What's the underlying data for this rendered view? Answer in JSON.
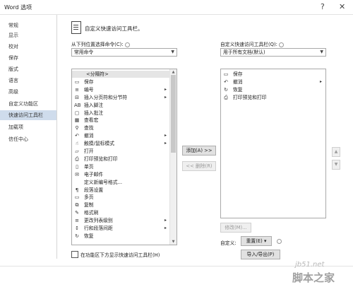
{
  "window": {
    "title": "Word 选项",
    "help_glyph": "?",
    "close_glyph": "✕"
  },
  "nav": {
    "items": [
      {
        "label": "常规"
      },
      {
        "label": "显示"
      },
      {
        "label": "校对"
      },
      {
        "label": "保存"
      },
      {
        "label": "版式"
      },
      {
        "label": "语言"
      },
      {
        "label": "高级"
      },
      {
        "label": "自定义功能区"
      },
      {
        "label": "快速访问工具栏",
        "active": true
      },
      {
        "label": "加载项"
      },
      {
        "label": "信任中心"
      }
    ]
  },
  "header": {
    "text": "自定义快速访问工具栏。"
  },
  "left": {
    "choose_label": "从下列位置选择命令(C):",
    "choose_value": "常用命令",
    "commands": [
      {
        "label": "<分隔符>",
        "icon": "",
        "selected": true
      },
      {
        "label": "保存",
        "icon": "▭"
      },
      {
        "label": "编号",
        "icon": "≡",
        "submenu": true
      },
      {
        "label": "插入分页符和分节符",
        "icon": "⊟",
        "submenu": true
      },
      {
        "label": "插入脚注",
        "icon": "AB"
      },
      {
        "label": "插入批注",
        "icon": "▢"
      },
      {
        "label": "查看宏",
        "icon": "▦"
      },
      {
        "label": "查找",
        "icon": "⚲"
      },
      {
        "label": "撤消",
        "icon": "↶",
        "submenu": true
      },
      {
        "label": "触摸/鼠标模式",
        "icon": "☝",
        "submenu": true
      },
      {
        "label": "打开",
        "icon": "▱"
      },
      {
        "label": "打印预览和打印",
        "icon": "⎙"
      },
      {
        "label": "单页",
        "icon": "▯"
      },
      {
        "label": "电子邮件",
        "icon": "✉"
      },
      {
        "label": "定义新编号格式...",
        "icon": ""
      },
      {
        "label": "段落设置",
        "icon": "¶"
      },
      {
        "label": "多页",
        "icon": "▭"
      },
      {
        "label": "复制",
        "icon": "⧉"
      },
      {
        "label": "格式刷",
        "icon": "✎"
      },
      {
        "label": "更改列表级别",
        "icon": "≡",
        "submenu": true
      },
      {
        "label": "行和段落间距",
        "icon": "↕",
        "submenu": true
      },
      {
        "label": "恢复",
        "icon": "↻"
      }
    ],
    "below_checkbox": "在功能区下方显示快速访问工具栏(H)"
  },
  "middle": {
    "add_button": "添加(A) >>",
    "remove_button": "<< 删除(R)"
  },
  "right": {
    "customize_label": "自定义快速访问工具栏(Q):",
    "customize_value": "用于所有文档(默认)",
    "items": [
      {
        "label": "保存",
        "icon": "▭"
      },
      {
        "label": "撤消",
        "icon": "↶",
        "submenu": true
      },
      {
        "label": "恢复",
        "icon": "↻"
      },
      {
        "label": "打印预览和打印",
        "icon": "⎙"
      }
    ],
    "modify_button": "修改(M)...",
    "customize_prefix": "自定义:",
    "reset_button": "重置(E) ▾",
    "import_export_button": "导入/导出(P)",
    "up_arrow": "▲",
    "down_arrow": "▼"
  },
  "watermark": {
    "line1": "jb51.net",
    "line2": "脚本之家"
  }
}
